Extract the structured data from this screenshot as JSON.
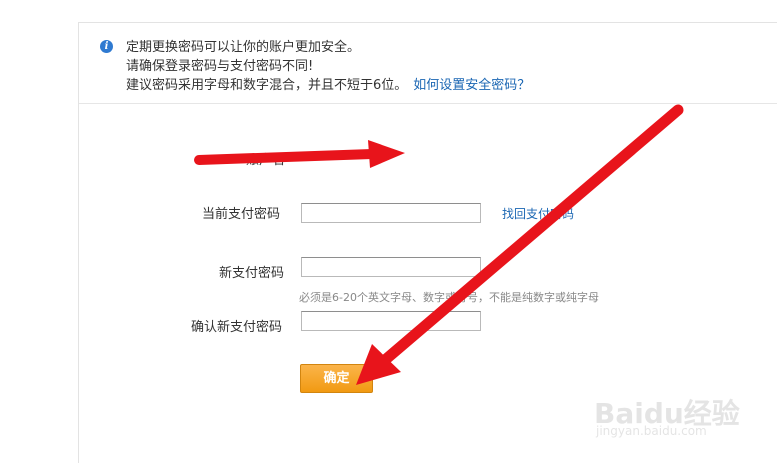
{
  "notice": {
    "line1": "定期更换密码可以让你的账户更加安全。",
    "line2": "请确保登录密码与支付密码不同!",
    "line3": "建议密码采用字母和数字混合，并且不短于6位。",
    "help_link": "如何设置安全密码？"
  },
  "form": {
    "account_label": "账户名",
    "current_label": "当前支付密码",
    "find_link": "找回支付密码",
    "new_label": "新支付密码",
    "new_hint": "必须是6-20个英文字母、数字或符号，不能是纯数字或纯字母",
    "confirm_label": "确认新支付密码",
    "submit_label": "确定"
  },
  "watermark": {
    "brand": "Baidu经验",
    "url": "jingyan.baidu.com"
  },
  "colors": {
    "link": "#1a66b3",
    "button": "#f19a12",
    "arrow": "#e8141b"
  }
}
